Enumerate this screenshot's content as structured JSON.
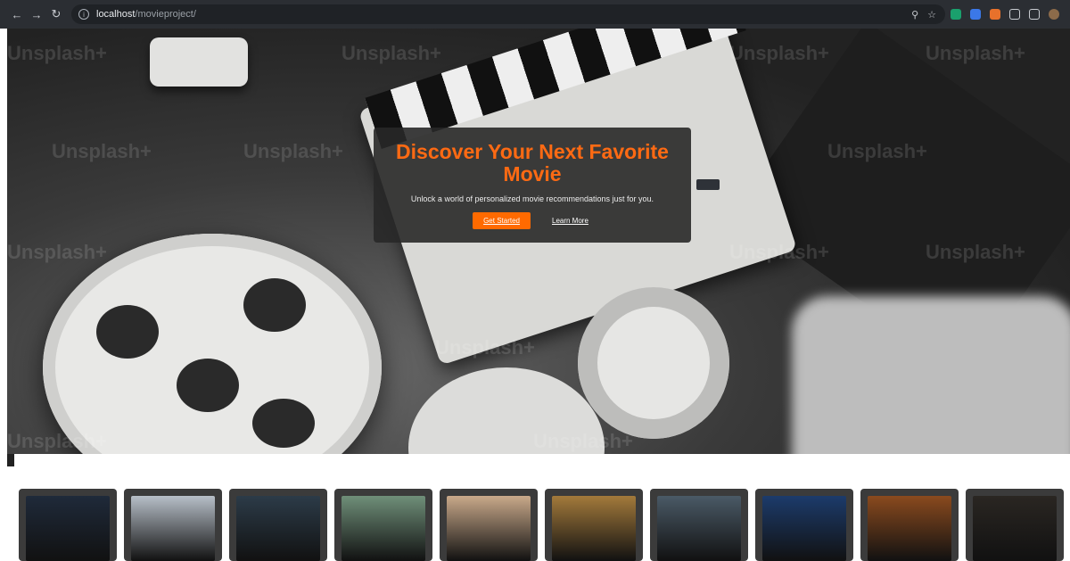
{
  "browser": {
    "url_host": "localhost",
    "url_path": "/movieproject/",
    "icons": [
      "back-icon",
      "forward-icon",
      "reload-icon",
      "info-icon",
      "zoom-icon",
      "star-icon"
    ]
  },
  "hero": {
    "title": "Discover Your Next Favorite Movie",
    "subtitle": "Unlock a world of personalized movie recommendations just for you.",
    "primary_button": "Get Started",
    "secondary_button": "Learn More",
    "watermark_text": "Unsplash+",
    "accent_color": "#ff6a13"
  },
  "posters": [
    {
      "name": "poster-1",
      "color": "#1f2a3a"
    },
    {
      "name": "poster-2",
      "color": "#b7bfc8"
    },
    {
      "name": "poster-3",
      "color": "#2c3b48"
    },
    {
      "name": "poster-4",
      "color": "#6f8f79"
    },
    {
      "name": "poster-5",
      "color": "#c9a98a"
    },
    {
      "name": "poster-6",
      "color": "#a37a3b"
    },
    {
      "name": "poster-7",
      "color": "#4a5a66"
    },
    {
      "name": "poster-8",
      "color": "#1c3b6b"
    },
    {
      "name": "poster-9",
      "color": "#8a4a1e"
    },
    {
      "name": "poster-10",
      "color": "#2a2622"
    }
  ]
}
